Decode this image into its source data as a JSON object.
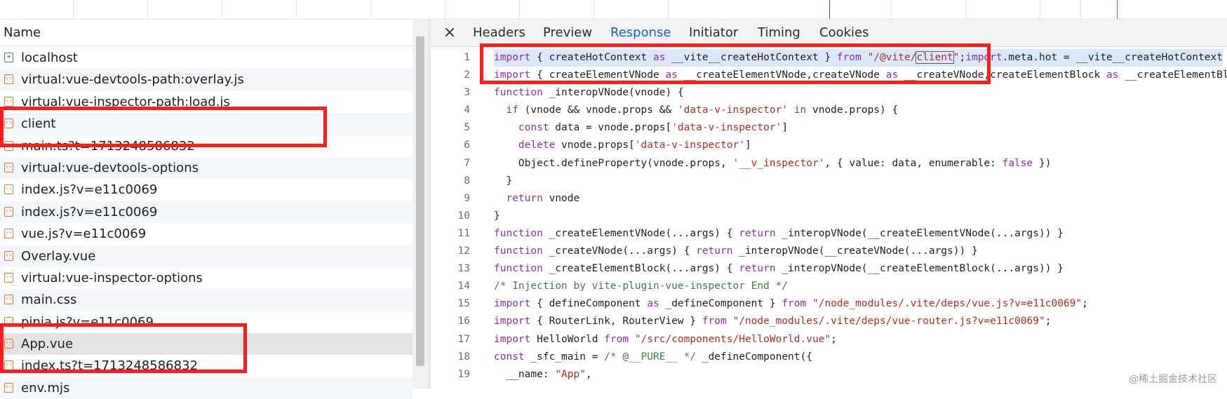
{
  "left_panel": {
    "column_header": "Name",
    "rows": [
      {
        "name": "localhost",
        "icon": "document-icon"
      },
      {
        "name": "virtual:vue-devtools-path:overlay.js",
        "icon": "script-icon"
      },
      {
        "name": "virtual:vue-inspector-path:load.js",
        "icon": "script-icon"
      },
      {
        "name": "client",
        "icon": "script-icon"
      },
      {
        "name": "main.ts?t=1713248586832",
        "icon": "script-icon"
      },
      {
        "name": "virtual:vue-devtools-options",
        "icon": "script-icon"
      },
      {
        "name": "index.js?v=e11c0069",
        "icon": "script-icon"
      },
      {
        "name": "index.js?v=e11c0069",
        "icon": "script-icon"
      },
      {
        "name": "vue.js?v=e11c0069",
        "icon": "script-icon"
      },
      {
        "name": "Overlay.vue",
        "icon": "script-icon"
      },
      {
        "name": "virtual:vue-inspector-options",
        "icon": "script-icon"
      },
      {
        "name": "main.css",
        "icon": "script-icon"
      },
      {
        "name": "pinia.js?v=e11c0069",
        "icon": "script-icon"
      },
      {
        "name": "App.vue",
        "icon": "script-icon"
      },
      {
        "name": "index.ts?t=1713248586832",
        "icon": "script-icon"
      },
      {
        "name": "env.mjs",
        "icon": "script-icon"
      }
    ]
  },
  "detail_panel": {
    "close_label": "×",
    "tabs": [
      "Headers",
      "Preview",
      "Response",
      "Initiator",
      "Timing",
      "Cookies"
    ],
    "active_tab": "Response",
    "line_numbers": [
      "1",
      "2",
      "3",
      "4",
      "5",
      "6",
      "7",
      "8",
      "9",
      "10",
      "11",
      "12",
      "13",
      "14",
      "15",
      "16",
      "17",
      "18",
      "19"
    ]
  },
  "code_lines": [
    "import { createHotContext as __vite__createHotContext } from \"/@vite/client\";import.meta.hot = __vite__createHotContext",
    "import { createElementVNode as __createElementVNode,createVNode as __createVNode,createElementBlock as __createElementBlock",
    "function _interopVNode(vnode) {",
    "  if (vnode && vnode.props && 'data-v-inspector' in vnode.props) {",
    "    const data = vnode.props['data-v-inspector']",
    "    delete vnode.props['data-v-inspector']",
    "    Object.defineProperty(vnode.props, '__v_inspector', { value: data, enumerable: false })",
    "  }",
    "  return vnode",
    "}",
    "function _createElementVNode(...args) { return _interopVNode(__createElementVNode(...args)) }",
    "function _createVNode(...args) { return _interopVNode(__createVNode(...args)) }",
    "function _createElementBlock(...args) { return _interopVNode(__createElementBlock(...args)) }",
    "/* Injection by vite-plugin-vue-inspector End */",
    "import { defineComponent as _defineComponent } from \"/node_modules/.vite/deps/vue.js?v=e11c0069\";",
    "import { RouterLink, RouterView } from \"/node_modules/.vite/deps/vue-router.js?v=e11c0069\";",
    "import HelloWorld from \"/src/components/HelloWorld.vue\";",
    "const _sfc_main = /* @__PURE__ */ _defineComponent({",
    "  __name: \"App\","
  ],
  "watermark": "@稀土掘金技术社区",
  "colors": {
    "accent": "#1a5fd0",
    "annotation": "#ff1c1c"
  }
}
